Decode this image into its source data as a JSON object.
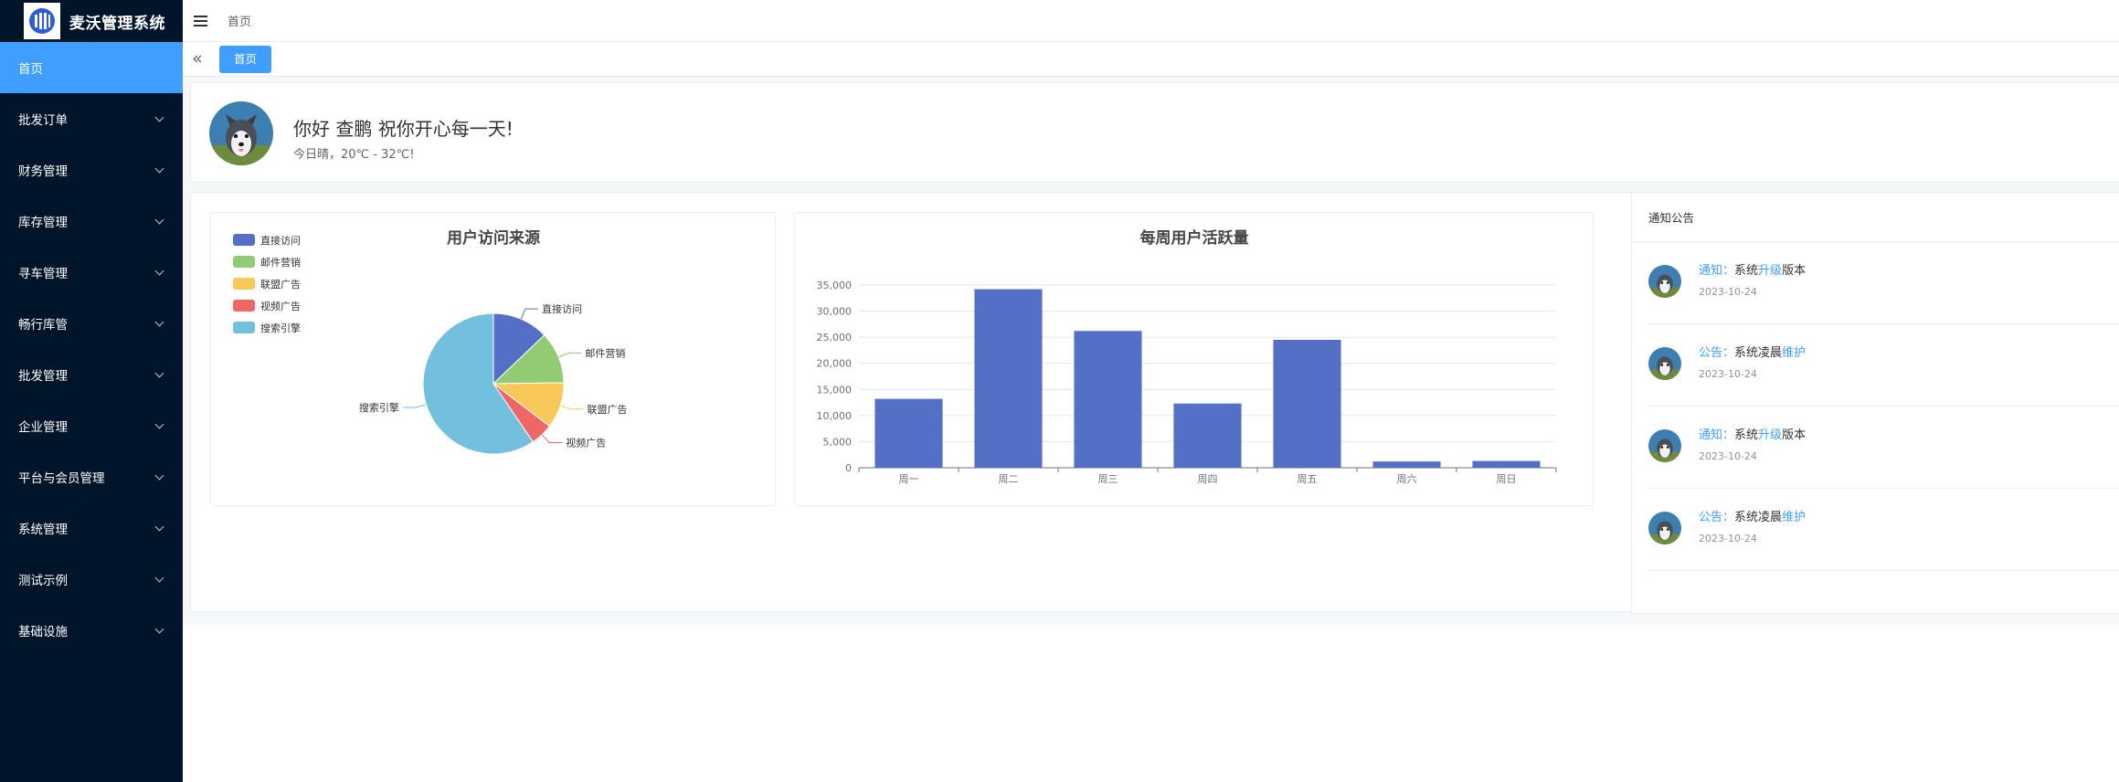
{
  "app": {
    "title": "麦沃管理系统"
  },
  "sidebar": {
    "items": [
      {
        "label": "首页",
        "active": true,
        "expandable": false
      },
      {
        "label": "批发订单",
        "expandable": true
      },
      {
        "label": "财务管理",
        "expandable": true
      },
      {
        "label": "库存管理",
        "expandable": true
      },
      {
        "label": "寻车管理",
        "expandable": true
      },
      {
        "label": "畅行库管",
        "expandable": true
      },
      {
        "label": "批发管理",
        "expandable": true
      },
      {
        "label": "企业管理",
        "expandable": true
      },
      {
        "label": "平台与会员管理",
        "expandable": true
      },
      {
        "label": "系统管理",
        "expandable": true
      },
      {
        "label": "测试示例",
        "expandable": true
      },
      {
        "label": "基础设施",
        "expandable": true
      }
    ]
  },
  "header": {
    "breadcrumb": "首页"
  },
  "tags": {
    "active_tag": "首页"
  },
  "welcome": {
    "greeting": "你好 查鹏 祝你开心每一天!",
    "weather": "今日晴，20℃ - 32℃!"
  },
  "notices": {
    "title": "通知公告",
    "items": [
      {
        "type": "通知",
        "sep": "：",
        "pre": "系统",
        "highlight": "升级",
        "post": "版本",
        "date": "2023-10-24"
      },
      {
        "type": "公告",
        "sep": "：",
        "pre": "系统凌晨",
        "highlight": "维护",
        "post": "",
        "date": "2023-10-24"
      },
      {
        "type": "通知",
        "sep": "：",
        "pre": "系统",
        "highlight": "升级",
        "post": "版本",
        "date": "2023-10-24"
      },
      {
        "type": "公告",
        "sep": "：",
        "pre": "系统凌晨",
        "highlight": "维护",
        "post": "",
        "date": "2023-10-24"
      }
    ]
  },
  "colors": {
    "accent": "#409eff",
    "sidebar_bg": "#001529",
    "bar": "#5470c6"
  },
  "chart_data": [
    {
      "type": "pie",
      "title": "用户访问来源",
      "legend_position": "top-left",
      "slices": [
        {
          "name": "直接访问",
          "value": 335,
          "color": "#5470c6"
        },
        {
          "name": "邮件营销",
          "value": 310,
          "color": "#91cc75"
        },
        {
          "name": "联盟广告",
          "value": 274,
          "color": "#fac858"
        },
        {
          "name": "视频广告",
          "value": 135,
          "color": "#ee6666"
        },
        {
          "name": "搜索引擎",
          "value": 1548,
          "color": "#73c0de"
        }
      ]
    },
    {
      "type": "bar",
      "title": "每周用户活跃量",
      "categories": [
        "周一",
        "周二",
        "周三",
        "周四",
        "周五",
        "周六",
        "周日"
      ],
      "values": [
        13200,
        34200,
        26200,
        12300,
        24500,
        1200,
        1300
      ],
      "ylim": [
        0,
        35000
      ],
      "yticks": [
        0,
        5000,
        10000,
        15000,
        20000,
        25000,
        30000,
        35000
      ],
      "ytick_labels": [
        "0",
        "5,000",
        "10,000",
        "15,000",
        "20,000",
        "25,000",
        "30,000",
        "35,000"
      ],
      "grid": true
    }
  ]
}
